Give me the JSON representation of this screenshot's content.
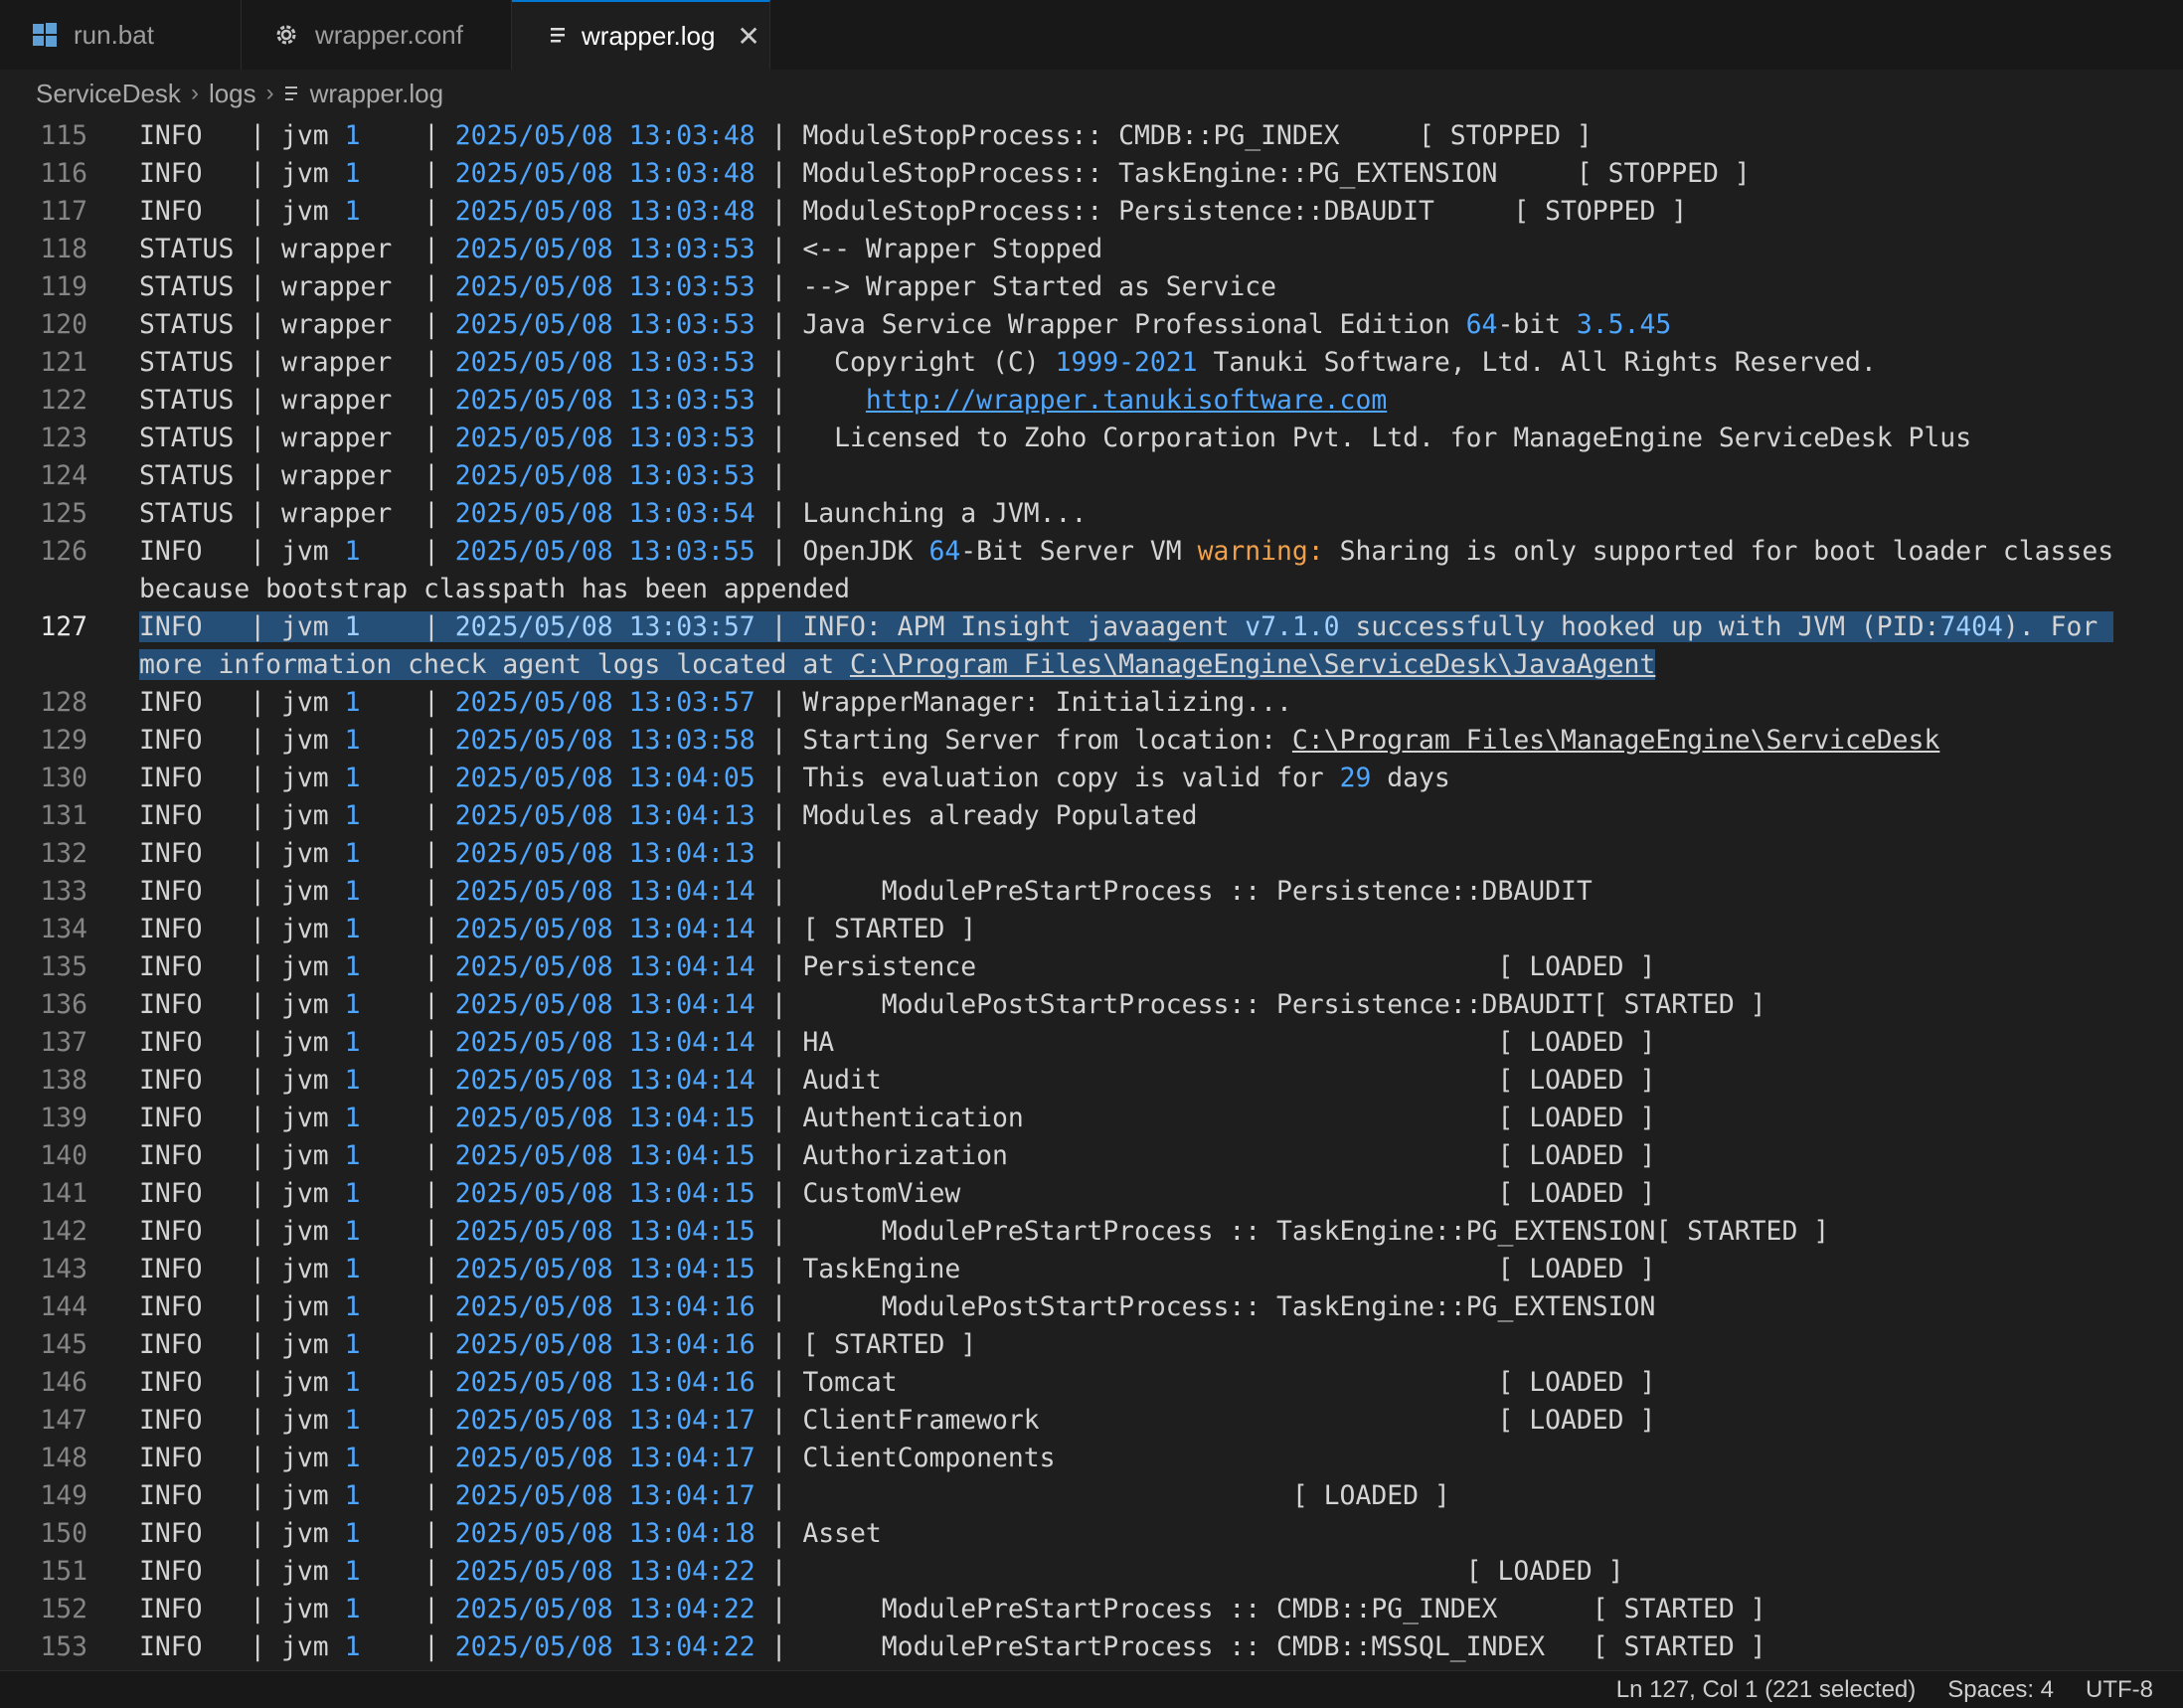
{
  "tabs": [
    {
      "label": "run.bat",
      "icon": "windows-icon"
    },
    {
      "label": "wrapper.conf",
      "icon": "gear-icon"
    },
    {
      "label": "wrapper.log",
      "icon": "lines-icon",
      "active": true
    }
  ],
  "breadcrumb": [
    "ServiceDesk",
    "logs",
    "wrapper.log"
  ],
  "editor": {
    "lines": [
      {
        "n": "115",
        "text": "INFO   | jvm 1    | 2025/05/08 13:03:48 | ModuleStopProcess:: CMDB::PG_INDEX     [ STOPPED ]"
      },
      {
        "n": "116",
        "text": "INFO   | jvm 1    | 2025/05/08 13:03:48 | ModuleStopProcess:: TaskEngine::PG_EXTENSION     [ STOPPED ]"
      },
      {
        "n": "117",
        "text": "INFO   | jvm 1    | 2025/05/08 13:03:48 | ModuleStopProcess:: Persistence::DBAUDIT     [ STOPPED ]"
      },
      {
        "n": "118",
        "text": "STATUS | wrapper  | 2025/05/08 13:03:53 | <-- Wrapper Stopped"
      },
      {
        "n": "119",
        "text": "STATUS | wrapper  | 2025/05/08 13:03:53 | --> Wrapper Started as Service"
      },
      {
        "n": "120",
        "text": "STATUS | wrapper  | 2025/05/08 13:03:53 | Java Service Wrapper Professional Edition 64-bit 3.5.45"
      },
      {
        "n": "121",
        "text": "STATUS | wrapper  | 2025/05/08 13:03:53 |   Copyright (C) 1999-2021 Tanuki Software, Ltd. All Rights Reserved."
      },
      {
        "n": "122",
        "text": "STATUS | wrapper  | 2025/05/08 13:03:53 |     http://wrapper.tanukisoftware.com"
      },
      {
        "n": "123",
        "text": "STATUS | wrapper  | 2025/05/08 13:03:53 |   Licensed to Zoho Corporation Pvt. Ltd. for ManageEngine ServiceDesk Plus"
      },
      {
        "n": "124",
        "text": "STATUS | wrapper  | 2025/05/08 13:03:53 |"
      },
      {
        "n": "125",
        "text": "STATUS | wrapper  | 2025/05/08 13:03:54 | Launching a JVM..."
      },
      {
        "n": "126",
        "text": "INFO   | jvm 1    | 2025/05/08 13:03:55 | OpenJDK 64-Bit Server VM warning: Sharing is only supported for boot loader classes because bootstrap classpath has been appended"
      },
      {
        "n": "127",
        "text": "INFO   | jvm 1    | 2025/05/08 13:03:57 | INFO: APM Insight javaagent v7.1.0 successfully hooked up with JVM (PID:7404). For more information check agent logs located at C:\\Program Files\\ManageEngine\\ServiceDesk\\JavaAgent"
      },
      {
        "n": "128",
        "text": "INFO   | jvm 1    | 2025/05/08 13:03:57 | WrapperManager: Initializing..."
      },
      {
        "n": "129",
        "text": "INFO   | jvm 1    | 2025/05/08 13:03:58 | Starting Server from location: C:\\Program Files\\ManageEngine\\ServiceDesk"
      },
      {
        "n": "130",
        "text": "INFO   | jvm 1    | 2025/05/08 13:04:05 | This evaluation copy is valid for 29 days"
      },
      {
        "n": "131",
        "text": "INFO   | jvm 1    | 2025/05/08 13:04:13 | Modules already Populated"
      },
      {
        "n": "132",
        "text": "INFO   | jvm 1    | 2025/05/08 13:04:13 |"
      },
      {
        "n": "133",
        "text": "INFO   | jvm 1    | 2025/05/08 13:04:14 |      ModulePreStartProcess :: Persistence::DBAUDIT"
      },
      {
        "n": "134",
        "text": "INFO   | jvm 1    | 2025/05/08 13:04:14 | [ STARTED ]"
      },
      {
        "n": "135",
        "text": "INFO   | jvm 1    | 2025/05/08 13:04:14 | Persistence                                 [ LOADED ]"
      },
      {
        "n": "136",
        "text": "INFO   | jvm 1    | 2025/05/08 13:04:14 |      ModulePostStartProcess:: Persistence::DBAUDIT[ STARTED ]"
      },
      {
        "n": "137",
        "text": "INFO   | jvm 1    | 2025/05/08 13:04:14 | HA                                          [ LOADED ]"
      },
      {
        "n": "138",
        "text": "INFO   | jvm 1    | 2025/05/08 13:04:14 | Audit                                       [ LOADED ]"
      },
      {
        "n": "139",
        "text": "INFO   | jvm 1    | 2025/05/08 13:04:15 | Authentication                              [ LOADED ]"
      },
      {
        "n": "140",
        "text": "INFO   | jvm 1    | 2025/05/08 13:04:15 | Authorization                               [ LOADED ]"
      },
      {
        "n": "141",
        "text": "INFO   | jvm 1    | 2025/05/08 13:04:15 | CustomView                                  [ LOADED ]"
      },
      {
        "n": "142",
        "text": "INFO   | jvm 1    | 2025/05/08 13:04:15 |      ModulePreStartProcess :: TaskEngine::PG_EXTENSION[ STARTED ]"
      },
      {
        "n": "143",
        "text": "INFO   | jvm 1    | 2025/05/08 13:04:15 | TaskEngine                                  [ LOADED ]"
      },
      {
        "n": "144",
        "text": "INFO   | jvm 1    | 2025/05/08 13:04:16 |      ModulePostStartProcess:: TaskEngine::PG_EXTENSION"
      },
      {
        "n": "145",
        "text": "INFO   | jvm 1    | 2025/05/08 13:04:16 | [ STARTED ]"
      },
      {
        "n": "146",
        "text": "INFO   | jvm 1    | 2025/05/08 13:04:16 | Tomcat                                      [ LOADED ]"
      },
      {
        "n": "147",
        "text": "INFO   | jvm 1    | 2025/05/08 13:04:17 | ClientFramework                             [ LOADED ]"
      },
      {
        "n": "148",
        "text": "INFO   | jvm 1    | 2025/05/08 13:04:17 | ClientComponents"
      },
      {
        "n": "149",
        "text": "INFO   | jvm 1    | 2025/05/08 13:04:17 |                                [ LOADED ]"
      },
      {
        "n": "150",
        "text": "INFO   | jvm 1    | 2025/05/08 13:04:18 | Asset"
      },
      {
        "n": "151",
        "text": "INFO   | jvm 1    | 2025/05/08 13:04:22 |                                           [ LOADED ]"
      },
      {
        "n": "152",
        "text": "INFO   | jvm 1    | 2025/05/08 13:04:22 |      ModulePreStartProcess :: CMDB::PG_INDEX      [ STARTED ]"
      },
      {
        "n": "153",
        "text": "INFO   | jvm 1    | 2025/05/08 13:04:22 |      ModulePreStartProcess :: CMDB::MSSQL_INDEX   [ STARTED ]"
      }
    ]
  },
  "status_bar": {
    "position": "Ln 127, Col 1 (221 selected)",
    "spaces": "Spaces: 4",
    "encoding": "UTF-8"
  },
  "colors": {
    "background": "#1e1e1e",
    "selection": "#264f78",
    "number": "#4fa6ff",
    "warning": "#f0a04b",
    "accent": "#0078d4"
  }
}
